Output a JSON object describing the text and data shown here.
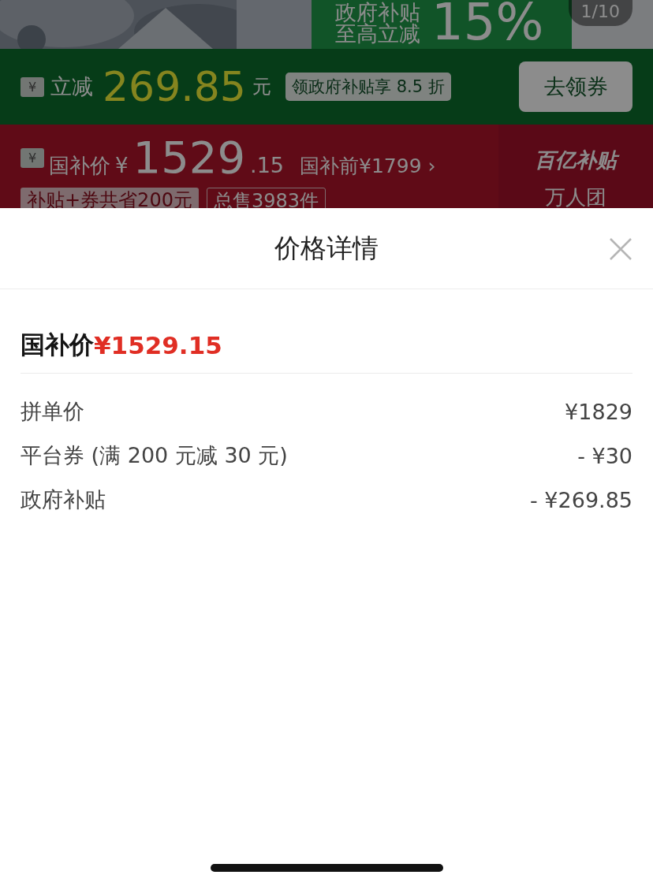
{
  "banner": {
    "promo_line_1": "政府补贴",
    "promo_line_2": "至高立减",
    "promo_percent": "15%",
    "page_counter": "1/10"
  },
  "discount_bar": {
    "icon_char": "¥",
    "label": "立减",
    "amount": "269.85",
    "unit": "元",
    "tip": "领政府补贴享 8.5 折",
    "button": "去领券"
  },
  "price_bar": {
    "icon_char": "¥",
    "label": "国补价",
    "currency": "¥",
    "price_int": "1529",
    "price_dec": ".15",
    "before": "国补前¥1799 ›",
    "tag": "补贴+券共省200元",
    "sold": "总售3983件",
    "brand": "百亿补贴",
    "group": "万人团"
  },
  "sheet": {
    "title": "价格详情",
    "final_label": "国补价",
    "final_price": "¥1529.15",
    "rows": [
      {
        "label": "拼单价",
        "value": "¥1829"
      },
      {
        "label": "平台券 (满 200 元减 30 元)",
        "value": "- ¥30"
      },
      {
        "label": "政府补贴",
        "value": "- ¥269.85"
      }
    ]
  }
}
